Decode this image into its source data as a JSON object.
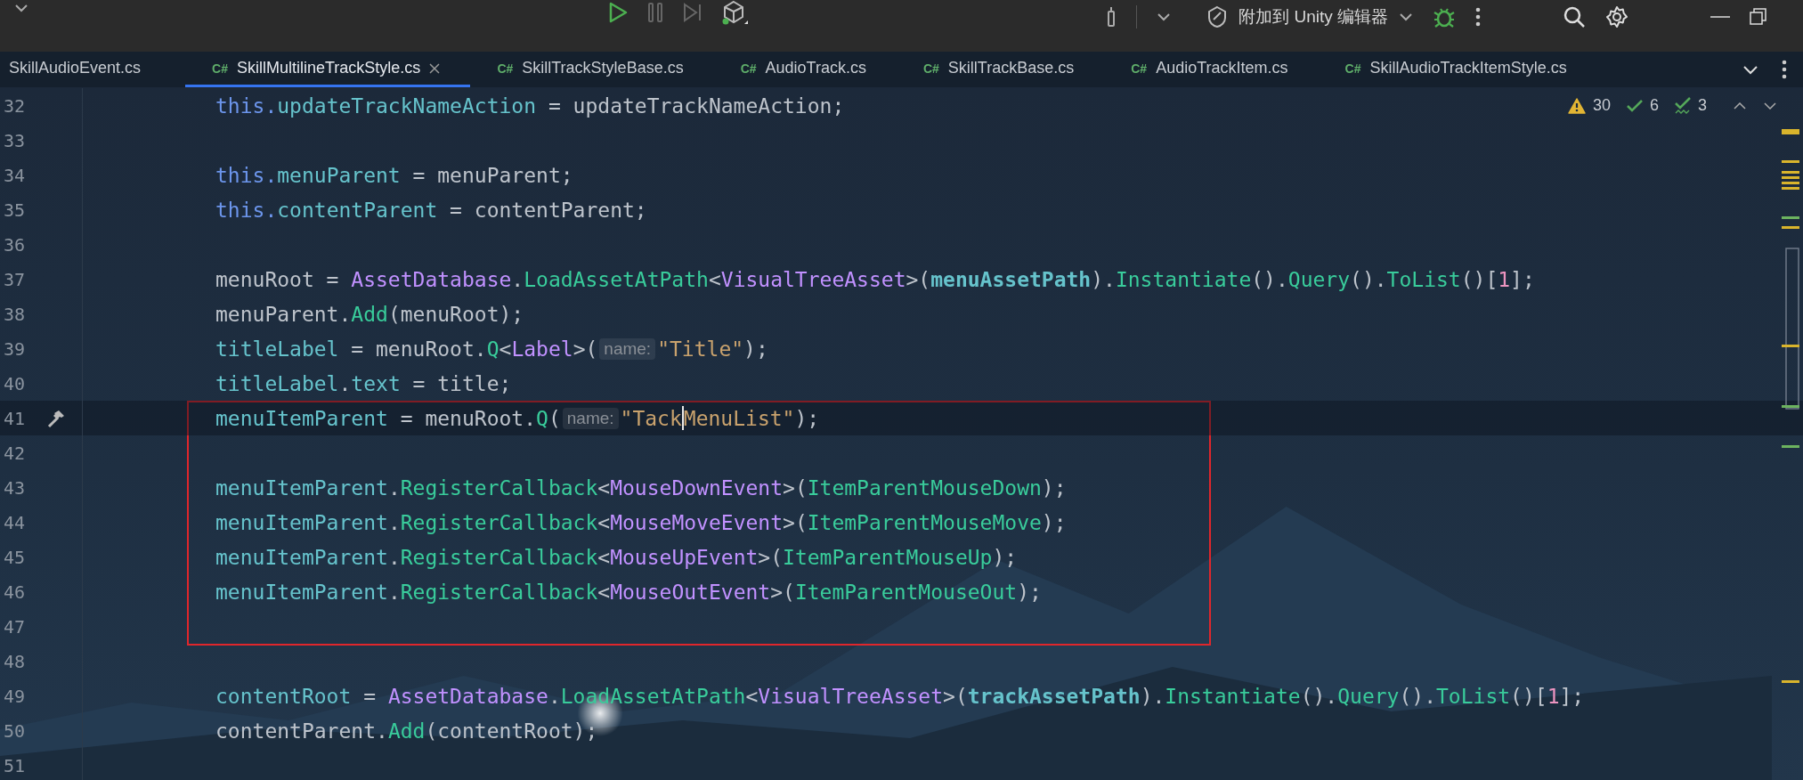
{
  "toolbar": {
    "attach_label": "附加到 Unity 编辑器"
  },
  "tabs": [
    {
      "label": "SkillAudioEvent.cs",
      "selected": false
    },
    {
      "label": "SkillMultilineTrackStyle.cs",
      "badge": "C#",
      "selected": true
    },
    {
      "label": "SkillTrackStyleBase.cs",
      "badge": "C#",
      "selected": false
    },
    {
      "label": "AudioTrack.cs",
      "badge": "C#",
      "selected": false
    },
    {
      "label": "SkillTrackBase.cs",
      "badge": "C#",
      "selected": false
    },
    {
      "label": "AudioTrackItem.cs",
      "badge": "C#",
      "selected": false
    },
    {
      "label": "SkillAudioTrackItemStyle.cs",
      "badge": "C#",
      "selected": false
    }
  ],
  "inspections": [
    {
      "kind": "warning",
      "count": "30"
    },
    {
      "kind": "ok",
      "count": "6"
    },
    {
      "kind": "typo",
      "count": "3"
    }
  ],
  "code_blocks": [
    {
      "kind": "plain",
      "lines": [
        {
          "number": "32",
          "current": false,
          "tokens": [
            {
              "kind": "kw",
              "text": "this."
            },
            {
              "kind": "field",
              "text": "updateTrackNameAction"
            },
            {
              "kind": "plain",
              "text": " = updateTrackNameAction;"
            }
          ]
        },
        {
          "number": "33",
          "current": false
        },
        {
          "number": "34",
          "current": false,
          "tokens": [
            {
              "kind": "kw",
              "text": "this."
            },
            {
              "kind": "field",
              "text": "menuParent"
            },
            {
              "kind": "plain",
              "text": " = menuParent;"
            }
          ]
        },
        {
          "number": "35",
          "current": false,
          "tokens": [
            {
              "kind": "kw",
              "text": "this."
            },
            {
              "kind": "field",
              "text": "contentParent"
            },
            {
              "kind": "plain",
              "text": " = contentParent;"
            }
          ]
        },
        {
          "number": "36",
          "current": false
        },
        {
          "number": "37",
          "current": false,
          "tokens": [
            {
              "kind": "plain",
              "text": "menuRoot = "
            },
            {
              "kind": "type",
              "text": "AssetDatabase"
            },
            {
              "kind": "plain",
              "text": "."
            },
            {
              "kind": "method",
              "text": "LoadAssetAtPath"
            },
            {
              "kind": "plain",
              "text": "<"
            },
            {
              "kind": "type",
              "text": "VisualTreeAsset"
            },
            {
              "kind": "plain",
              "text": ">("
            },
            {
              "kind": "bold",
              "text": "menuAssetPath"
            },
            {
              "kind": "plain",
              "text": ")."
            },
            {
              "kind": "method",
              "text": "Instantiate"
            },
            {
              "kind": "plain",
              "text": "()."
            },
            {
              "kind": "method",
              "text": "Query"
            },
            {
              "kind": "plain",
              "text": "()."
            },
            {
              "kind": "method",
              "text": "ToList"
            },
            {
              "kind": "plain",
              "text": "()["
            },
            {
              "kind": "num",
              "text": "1"
            },
            {
              "kind": "plain",
              "text": "];"
            }
          ]
        },
        {
          "number": "38",
          "current": false,
          "tokens": [
            {
              "kind": "plain",
              "text": "menuParent."
            },
            {
              "kind": "method",
              "text": "Add"
            },
            {
              "kind": "plain",
              "text": "(menuRoot);"
            }
          ]
        },
        {
          "number": "39",
          "current": false,
          "tokens": [
            {
              "kind": "field",
              "text": "titleLabel"
            },
            {
              "kind": "plain",
              "text": " = menuRoot."
            },
            {
              "kind": "method",
              "text": "Q"
            },
            {
              "kind": "plain",
              "text": "<"
            },
            {
              "kind": "type",
              "text": "Label"
            },
            {
              "kind": "plain",
              "text": ">("
            },
            {
              "kind": "hint",
              "text": "name:"
            },
            {
              "kind": "string",
              "text": "\"Title\""
            },
            {
              "kind": "plain",
              "text": ");"
            }
          ]
        },
        {
          "number": "40",
          "current": false,
          "tokens": [
            {
              "kind": "field",
              "text": "titleLabel"
            },
            {
              "kind": "plain",
              "text": "."
            },
            {
              "kind": "field",
              "text": "text"
            },
            {
              "kind": "plain",
              "text": " = title;"
            }
          ]
        }
      ]
    },
    {
      "kind": "boxed",
      "lines": [
        {
          "number": "41",
          "current": true,
          "kind": "hammer",
          "tokens": [
            {
              "kind": "field",
              "text": "menuItemParent"
            },
            {
              "kind": "plain",
              "text": " = menuRoot."
            },
            {
              "kind": "method",
              "text": "Q"
            },
            {
              "kind": "plain",
              "text": "("
            },
            {
              "kind": "hint",
              "text": "name:"
            },
            {
              "kind": "string",
              "text": "\"Tack"
            },
            {
              "kind": "caret"
            },
            {
              "kind": "string",
              "text": "MenuList\""
            },
            {
              "kind": "plain",
              "text": ");"
            }
          ]
        },
        {
          "number": "42",
          "current": false
        },
        {
          "number": "43",
          "current": false,
          "tokens": [
            {
              "kind": "field",
              "text": "menuItemParent"
            },
            {
              "kind": "plain",
              "text": "."
            },
            {
              "kind": "method",
              "text": "RegisterCallback"
            },
            {
              "kind": "plain",
              "text": "<"
            },
            {
              "kind": "type",
              "text": "MouseDownEvent"
            },
            {
              "kind": "plain",
              "text": ">("
            },
            {
              "kind": "method",
              "text": "ItemParentMouseDown"
            },
            {
              "kind": "plain",
              "text": ");"
            }
          ]
        },
        {
          "number": "44",
          "current": false,
          "tokens": [
            {
              "kind": "field",
              "text": "menuItemParent"
            },
            {
              "kind": "plain",
              "text": "."
            },
            {
              "kind": "method",
              "text": "RegisterCallback"
            },
            {
              "kind": "plain",
              "text": "<"
            },
            {
              "kind": "type",
              "text": "MouseMoveEvent"
            },
            {
              "kind": "plain",
              "text": ">("
            },
            {
              "kind": "method",
              "text": "ItemParentMouseMove"
            },
            {
              "kind": "plain",
              "text": ");"
            }
          ]
        },
        {
          "number": "45",
          "current": false,
          "tokens": [
            {
              "kind": "field",
              "text": "menuItemParent"
            },
            {
              "kind": "plain",
              "text": "."
            },
            {
              "kind": "method",
              "text": "RegisterCallback"
            },
            {
              "kind": "plain",
              "text": "<"
            },
            {
              "kind": "type",
              "text": "MouseUpEvent"
            },
            {
              "kind": "plain",
              "text": ">("
            },
            {
              "kind": "method",
              "text": "ItemParentMouseUp"
            },
            {
              "kind": "plain",
              "text": ");"
            }
          ]
        },
        {
          "number": "46",
          "current": false,
          "tokens": [
            {
              "kind": "field",
              "text": "menuItemParent"
            },
            {
              "kind": "plain",
              "text": "."
            },
            {
              "kind": "method",
              "text": "RegisterCallback"
            },
            {
              "kind": "plain",
              "text": "<"
            },
            {
              "kind": "type",
              "text": "MouseOutEvent"
            },
            {
              "kind": "plain",
              "text": ">("
            },
            {
              "kind": "method",
              "text": "ItemParentMouseOut"
            },
            {
              "kind": "plain",
              "text": ");"
            }
          ]
        },
        {
          "number": "47",
          "current": false
        }
      ]
    },
    {
      "kind": "plain",
      "lines": [
        {
          "number": "48",
          "current": false
        },
        {
          "number": "49",
          "current": false,
          "tokens": [
            {
              "kind": "field",
              "text": "contentRoot"
            },
            {
              "kind": "plain",
              "text": " = "
            },
            {
              "kind": "type",
              "text": "AssetDatabase"
            },
            {
              "kind": "plain",
              "text": "."
            },
            {
              "kind": "method",
              "text": "LoadAssetAtPath"
            },
            {
              "kind": "plain",
              "text": "<"
            },
            {
              "kind": "type",
              "text": "VisualTreeAsset"
            },
            {
              "kind": "plain",
              "text": ">("
            },
            {
              "kind": "bold",
              "text": "trackAssetPath"
            },
            {
              "kind": "plain",
              "text": ")."
            },
            {
              "kind": "method",
              "text": "Instantiate"
            },
            {
              "kind": "plain",
              "text": "()."
            },
            {
              "kind": "method",
              "text": "Query"
            },
            {
              "kind": "plain",
              "text": "()."
            },
            {
              "kind": "method",
              "text": "ToList"
            },
            {
              "kind": "plain",
              "text": "()["
            },
            {
              "kind": "num",
              "text": "1"
            },
            {
              "kind": "plain",
              "text": "];"
            }
          ]
        },
        {
          "number": "50",
          "current": false,
          "tokens": [
            {
              "kind": "plain",
              "text": "contentParent."
            },
            {
              "kind": "method",
              "text": "Add"
            },
            {
              "kind": "plain",
              "text": "(contentRoot);"
            }
          ]
        },
        {
          "number": "51",
          "current": false
        }
      ]
    }
  ]
}
